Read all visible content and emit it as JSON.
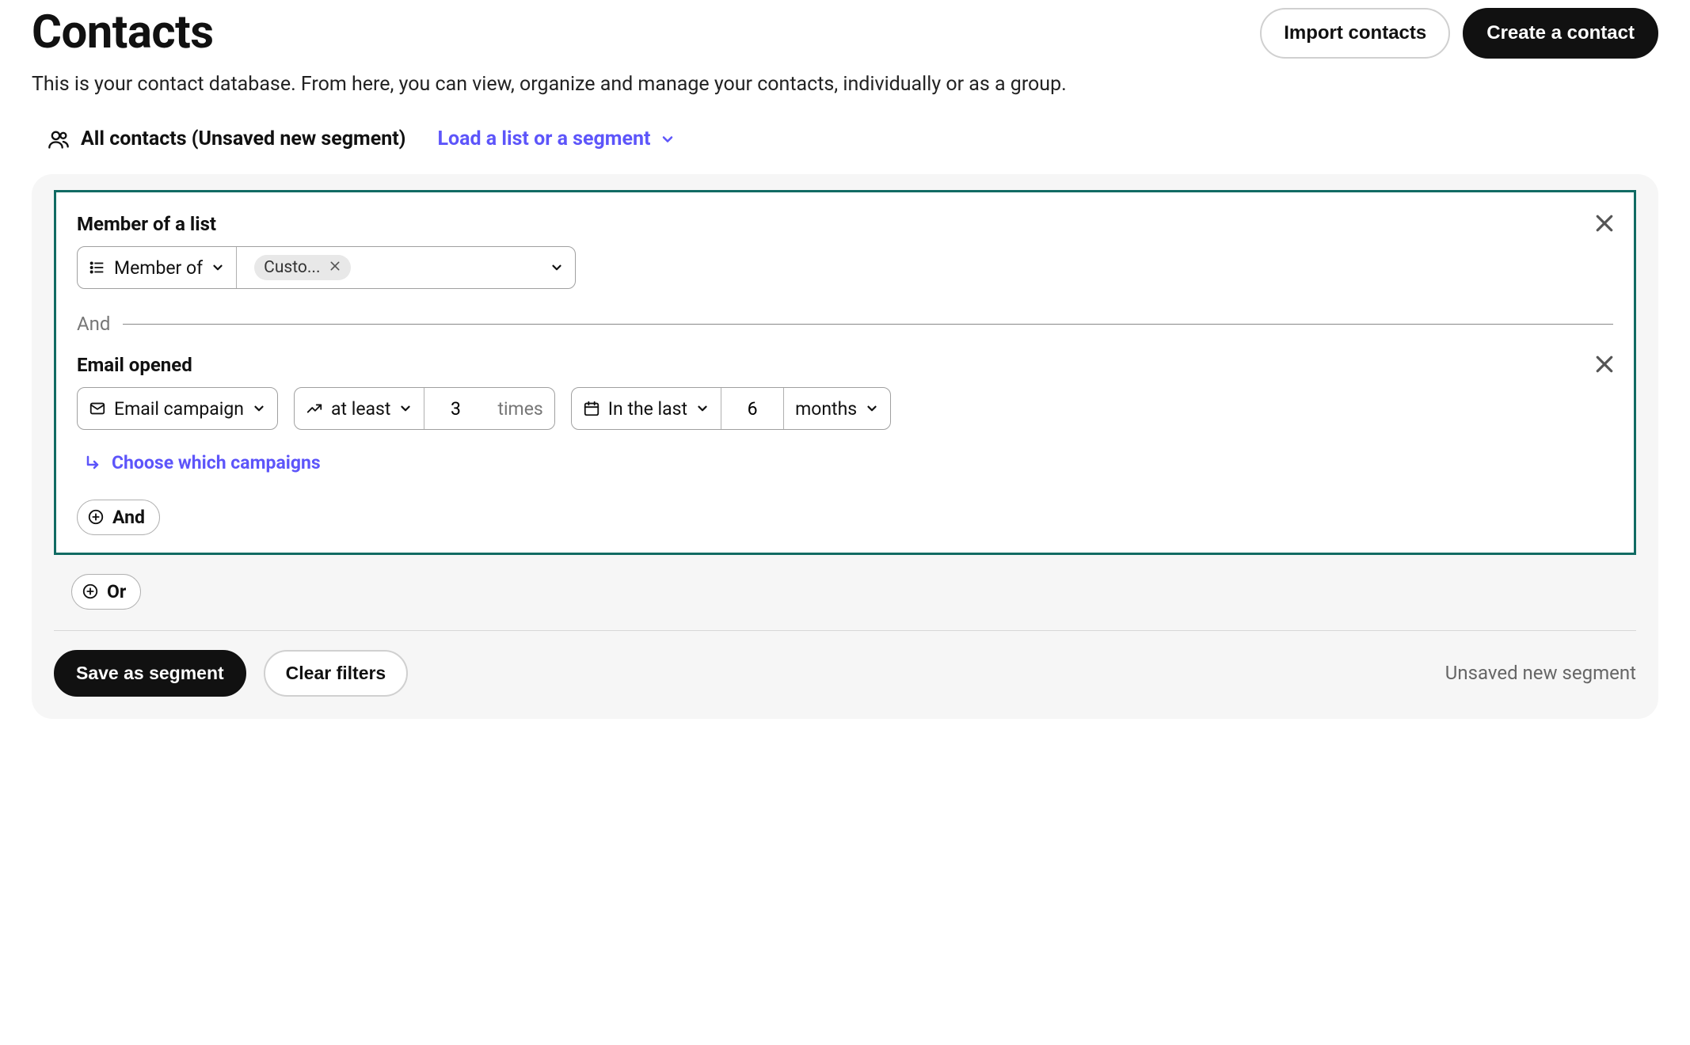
{
  "header": {
    "title": "Contacts",
    "subtitle": "This is your contact database. From here, you can view, organize and manage your contacts, individually or as a group.",
    "import_label": "Import contacts",
    "create_label": "Create a contact"
  },
  "segment_bar": {
    "current_label": "All contacts (Unsaved new segment)",
    "load_link": "Load a list or a segment"
  },
  "filters": {
    "group": {
      "conditions": [
        {
          "title": "Member of a list",
          "operator_label": "Member of",
          "chip_label": "Custo..."
        },
        {
          "title": "Email opened",
          "source_label": "Email campaign",
          "comparator_label": "at least",
          "count_value": "3",
          "count_unit": "times",
          "range_label": "In the last",
          "range_value": "6",
          "range_unit": "months",
          "choose_link": "Choose which campaigns"
        }
      ],
      "and_label": "And",
      "add_and_label": "And"
    },
    "add_or_label": "Or"
  },
  "footer": {
    "save_label": "Save as segment",
    "clear_label": "Clear filters",
    "status": "Unsaved new segment"
  }
}
